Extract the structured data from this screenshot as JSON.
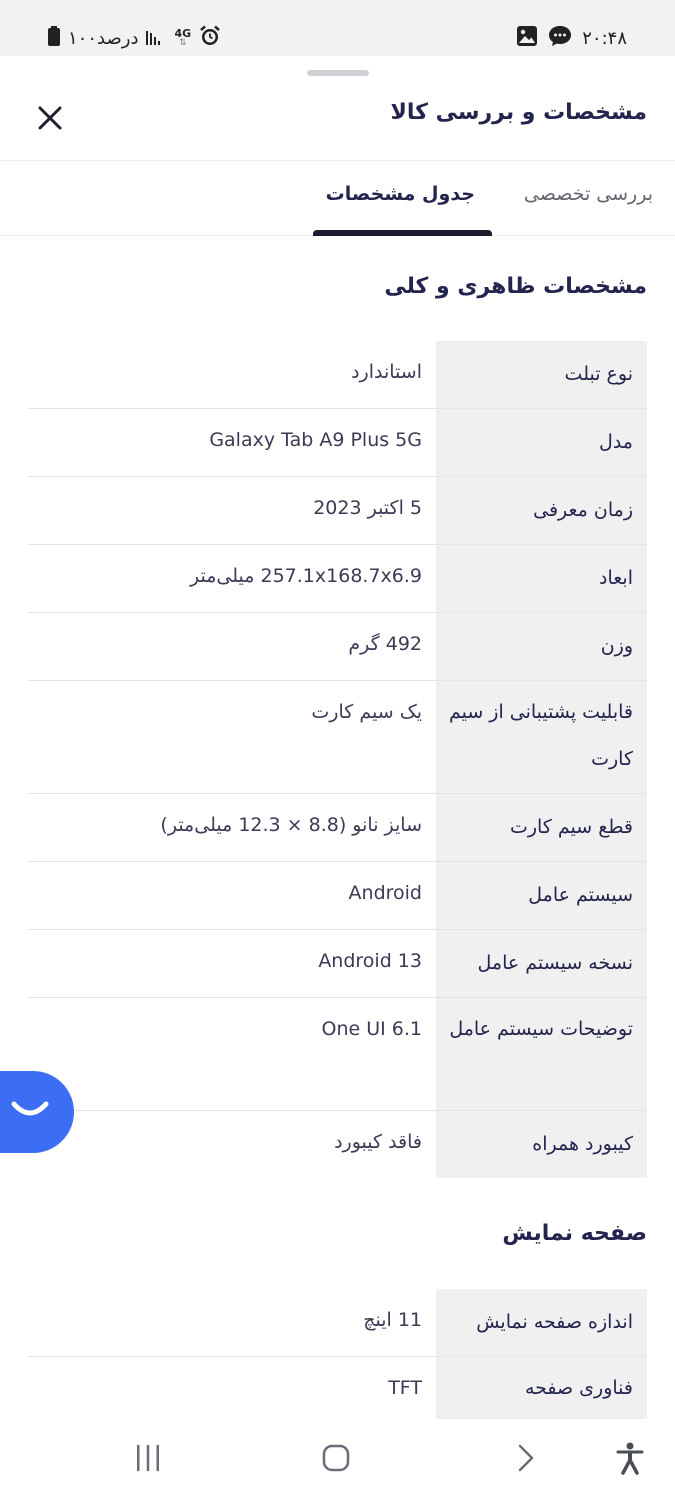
{
  "status_bar": {
    "time": "۲۰:۴۸",
    "battery_text": "۱۰۰درصد",
    "network_type": "4G",
    "icons": [
      "battery-icon",
      "signal-icon",
      "data-icon",
      "alarm-icon",
      "chat-bubble-icon",
      "gallery-icon"
    ]
  },
  "header": {
    "title": "مشخصات و بررسی کالا",
    "close_icon": "close-icon"
  },
  "tabs": [
    {
      "label": "بررسی تخصصی",
      "active": false
    },
    {
      "label": "جدول مشخصات",
      "active": true
    }
  ],
  "sections": [
    {
      "title": "مشخصات ظاهری و کلی",
      "rows": [
        {
          "key": "نوع تبلت",
          "value": "استاندارد"
        },
        {
          "key": "مدل",
          "value": "Galaxy Tab A9 Plus 5G"
        },
        {
          "key": "زمان معرفی",
          "value": "5 اکتبر 2023"
        },
        {
          "key": "ابعاد",
          "value": "257.1x168.7x6.9 میلی‌متر"
        },
        {
          "key": "وزن",
          "value": "492 گرم"
        },
        {
          "key": "قابلیت پشتیبانی از سیم کارت",
          "value": "یک سیم کارت"
        },
        {
          "key": "قطع سیم کارت",
          "value": "سایز نانو (8.8 × 12.3 میلی‌متر)"
        },
        {
          "key": "سیستم عامل",
          "value": "Android"
        },
        {
          "key": "نسخه سیستم عامل",
          "value": "Android 13"
        },
        {
          "key": "توضیحات سیستم عامل",
          "value": "One UI 6.1"
        },
        {
          "key": "کیبورد همراه",
          "value": "فاقد کیبورد"
        }
      ]
    },
    {
      "title": "صفحه نمایش",
      "rows": [
        {
          "key": "اندازه صفحه نمایش",
          "value": "11 اینچ"
        },
        {
          "key": "فناوری صفحه",
          "value": "TFT"
        }
      ]
    }
  ],
  "chat_fab": {
    "icon": "smile-chat-icon",
    "color": "#3c6ef4"
  },
  "nav_bar": {
    "icons": [
      "recents-icon",
      "home-icon",
      "back-icon",
      "accessibility-icon"
    ]
  },
  "colors": {
    "accent": "#3c6ef4",
    "text": "#23254e",
    "key_bg": "#f0f0f1",
    "tab_indicator": "#1b1c2e"
  }
}
